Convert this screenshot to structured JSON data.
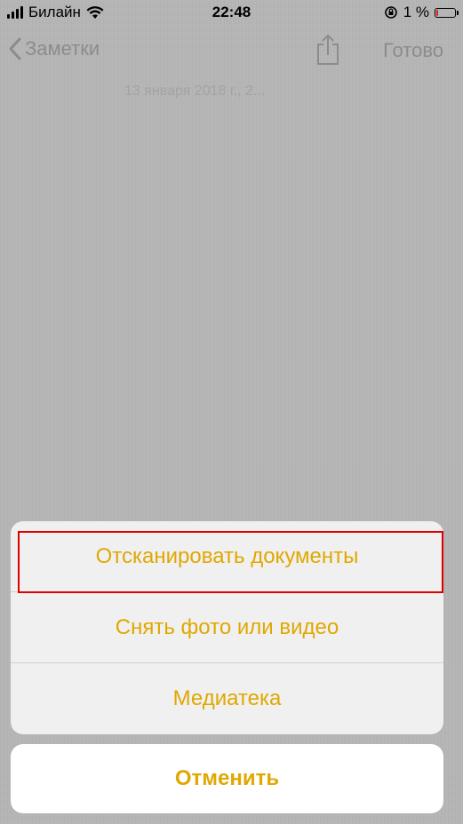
{
  "status_bar": {
    "carrier": "Билайн",
    "time": "22:48",
    "battery_percent": "1 %",
    "battery_level": 0.01
  },
  "nav": {
    "back_label": "Заметки",
    "done_label": "Готово",
    "faint_date": "13 января 2018 г., 2..."
  },
  "action_sheet": {
    "items": [
      {
        "label": "Отсканировать документы"
      },
      {
        "label": "Снять фото или видео"
      },
      {
        "label": "Медиатека"
      }
    ],
    "cancel_label": "Отменить"
  },
  "colors": {
    "accent": "#e0a800",
    "highlight": "#e00000",
    "battery_low": "#e02020"
  },
  "icons": {
    "signal": "cellular-signal-icon",
    "wifi": "wifi-icon",
    "orientation_lock": "orientation-lock-icon",
    "battery": "battery-icon",
    "back": "chevron-left-icon",
    "share": "share-icon"
  }
}
